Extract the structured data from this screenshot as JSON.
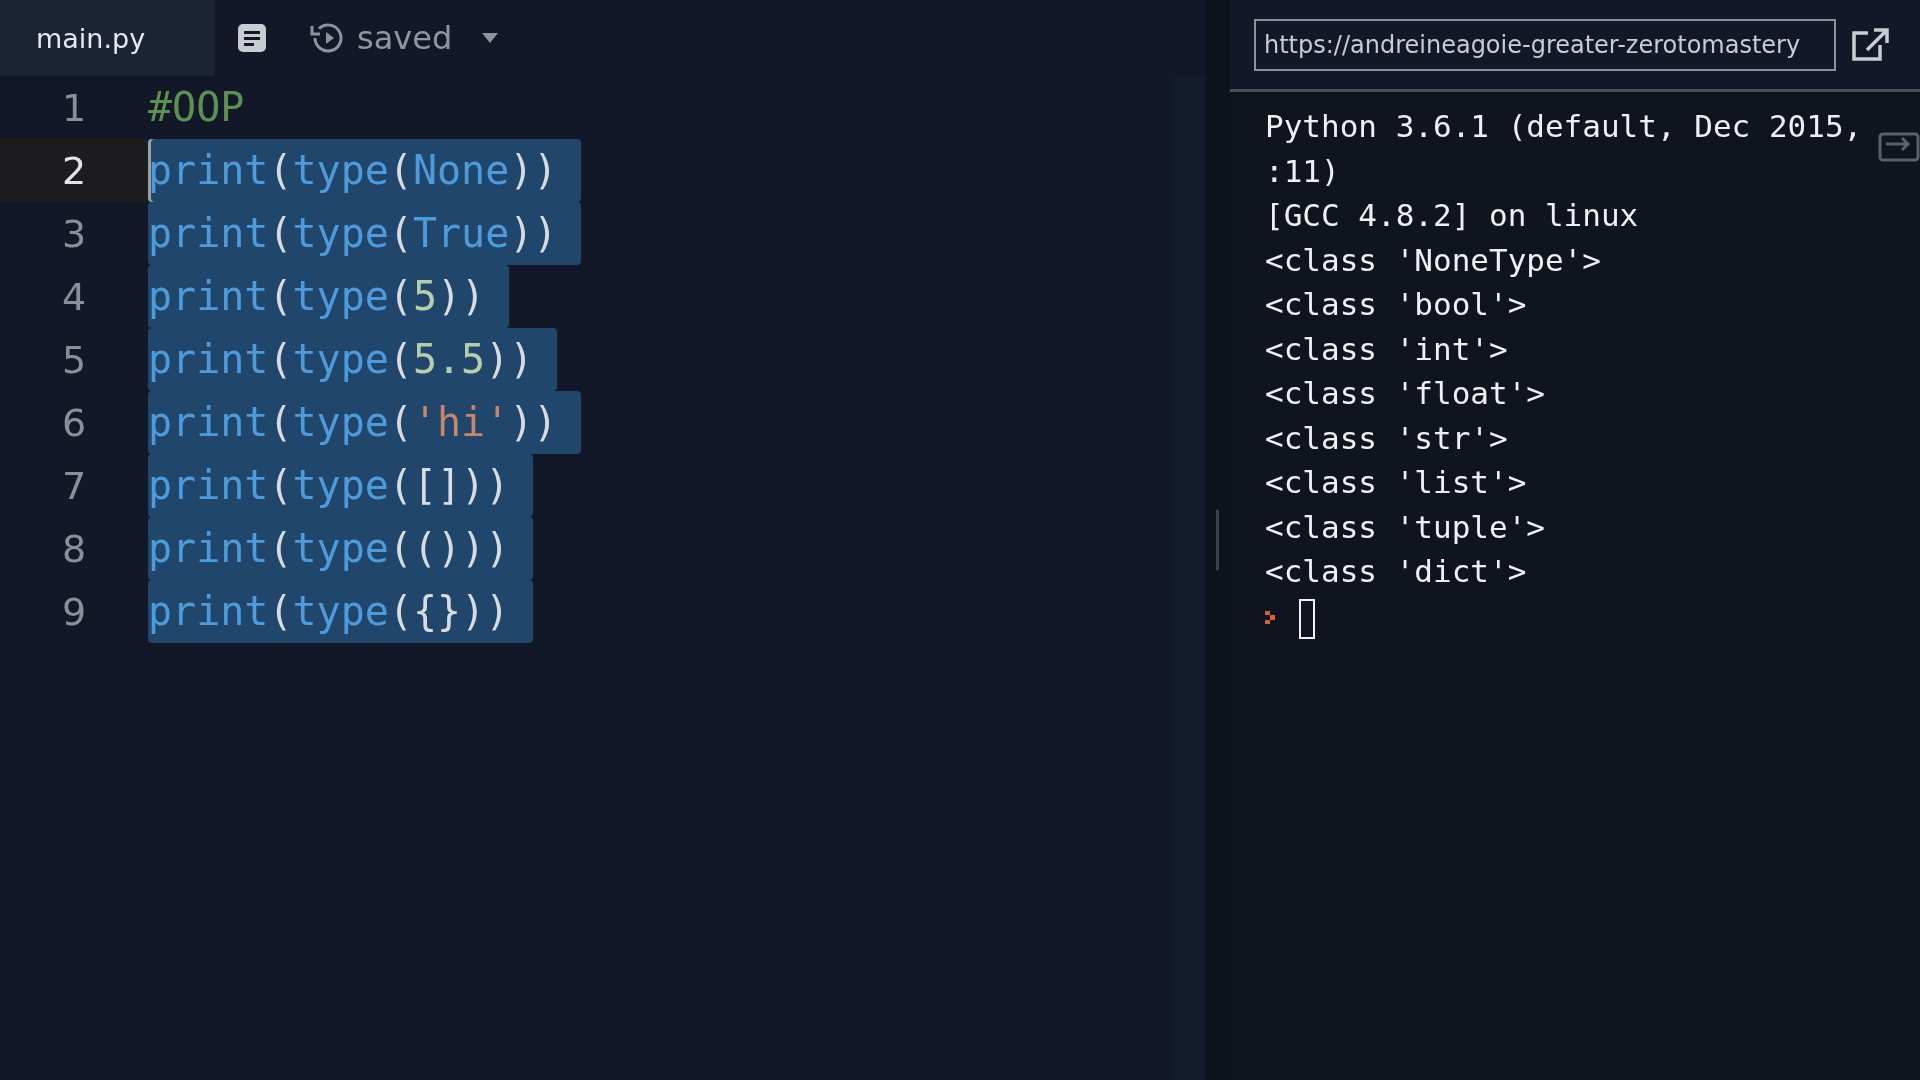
{
  "editor": {
    "tabs": [
      {
        "label": "main.py",
        "selected": true
      }
    ],
    "save_status": "saved",
    "lines": [
      {
        "number": "1",
        "current": false,
        "selected": false,
        "tokens": [
          {
            "kind": "comment",
            "text": "#OOP"
          }
        ]
      },
      {
        "number": "2",
        "current": true,
        "selected": true,
        "tokens": [
          {
            "kind": "builtin",
            "text": "print"
          },
          {
            "kind": "punct",
            "text": "("
          },
          {
            "kind": "builtin",
            "text": "type"
          },
          {
            "kind": "punct",
            "text": "("
          },
          {
            "kind": "constant",
            "text": "None"
          },
          {
            "kind": "punct",
            "text": "))"
          }
        ]
      },
      {
        "number": "3",
        "current": false,
        "selected": true,
        "tokens": [
          {
            "kind": "builtin",
            "text": "print"
          },
          {
            "kind": "punct",
            "text": "("
          },
          {
            "kind": "builtin",
            "text": "type"
          },
          {
            "kind": "punct",
            "text": "("
          },
          {
            "kind": "constant",
            "text": "True"
          },
          {
            "kind": "punct",
            "text": "))"
          }
        ]
      },
      {
        "number": "4",
        "current": false,
        "selected": true,
        "tokens": [
          {
            "kind": "builtin",
            "text": "print"
          },
          {
            "kind": "punct",
            "text": "("
          },
          {
            "kind": "builtin",
            "text": "type"
          },
          {
            "kind": "punct",
            "text": "("
          },
          {
            "kind": "number",
            "text": "5"
          },
          {
            "kind": "punct",
            "text": "))"
          }
        ]
      },
      {
        "number": "5",
        "current": false,
        "selected": true,
        "tokens": [
          {
            "kind": "builtin",
            "text": "print"
          },
          {
            "kind": "punct",
            "text": "("
          },
          {
            "kind": "builtin",
            "text": "type"
          },
          {
            "kind": "punct",
            "text": "("
          },
          {
            "kind": "number",
            "text": "5.5"
          },
          {
            "kind": "punct",
            "text": "))"
          }
        ]
      },
      {
        "number": "6",
        "current": false,
        "selected": true,
        "tokens": [
          {
            "kind": "builtin",
            "text": "print"
          },
          {
            "kind": "punct",
            "text": "("
          },
          {
            "kind": "builtin",
            "text": "type"
          },
          {
            "kind": "punct",
            "text": "("
          },
          {
            "kind": "string",
            "text": "'hi'"
          },
          {
            "kind": "punct",
            "text": "))"
          }
        ]
      },
      {
        "number": "7",
        "current": false,
        "selected": true,
        "tokens": [
          {
            "kind": "builtin",
            "text": "print"
          },
          {
            "kind": "punct",
            "text": "("
          },
          {
            "kind": "builtin",
            "text": "type"
          },
          {
            "kind": "punct",
            "text": "([]))"
          }
        ]
      },
      {
        "number": "8",
        "current": false,
        "selected": true,
        "tokens": [
          {
            "kind": "builtin",
            "text": "print"
          },
          {
            "kind": "punct",
            "text": "("
          },
          {
            "kind": "builtin",
            "text": "type"
          },
          {
            "kind": "punct",
            "text": "(()))"
          }
        ]
      },
      {
        "number": "9",
        "current": false,
        "selected": true,
        "tokens": [
          {
            "kind": "builtin",
            "text": "print"
          },
          {
            "kind": "punct",
            "text": "("
          },
          {
            "kind": "builtin",
            "text": "type"
          },
          {
            "kind": "punct",
            "text": "({}))"
          }
        ]
      }
    ]
  },
  "console": {
    "url": "https://andreineagoie-greater-zerotomastery",
    "output": [
      "Python 3.6.1 (default, Dec 2015,",
      ":11)",
      "[GCC 4.8.2] on linux",
      "<class 'NoneType'>",
      "<class 'bool'>",
      "<class 'int'>",
      "<class 'float'>",
      "<class 'str'>",
      "<class 'list'>",
      "<class 'tuple'>",
      "<class 'dict'>"
    ]
  }
}
